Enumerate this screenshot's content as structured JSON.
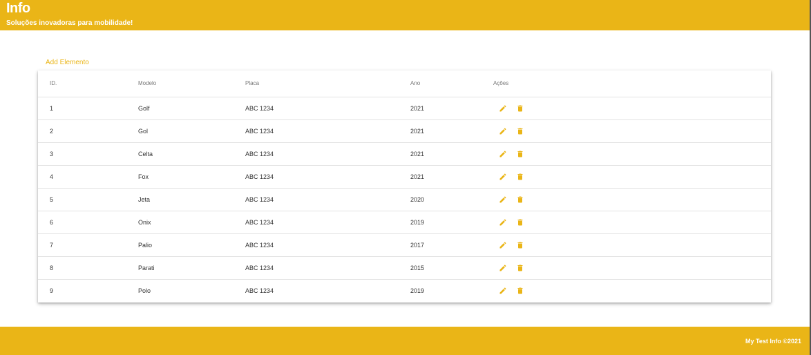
{
  "header": {
    "title": "Info",
    "subtitle": "Soluções inovadoras para mobilidade!"
  },
  "add_link": "Add Elemento",
  "table": {
    "columns": [
      "ID.",
      "Modelo",
      "Placa",
      "Ano",
      "Ações"
    ],
    "rows": [
      {
        "id": "1",
        "modelo": "Golf",
        "placa": "ABC 1234",
        "ano": "2021"
      },
      {
        "id": "2",
        "modelo": "Gol",
        "placa": "ABC 1234",
        "ano": "2021"
      },
      {
        "id": "3",
        "modelo": "Celta",
        "placa": "ABC 1234",
        "ano": "2021"
      },
      {
        "id": "4",
        "modelo": "Fox",
        "placa": "ABC 1234",
        "ano": "2021"
      },
      {
        "id": "5",
        "modelo": "Jeta",
        "placa": "ABC 1234",
        "ano": "2020"
      },
      {
        "id": "6",
        "modelo": "Onix",
        "placa": "ABC 1234",
        "ano": "2019"
      },
      {
        "id": "7",
        "modelo": "Palio",
        "placa": "ABC 1234",
        "ano": "2017"
      },
      {
        "id": "8",
        "modelo": "Parati",
        "placa": "ABC 1234",
        "ano": "2015"
      },
      {
        "id": "9",
        "modelo": "Polo",
        "placa": "ABC 1234",
        "ano": "2019"
      }
    ],
    "row_actions": [
      "pencil-icon",
      "trash-icon"
    ]
  },
  "footer": {
    "copyright": "My Test Info ©2021"
  },
  "colors": {
    "accent": "#eab517",
    "text": "#333333",
    "header_text": "#ffffff"
  }
}
